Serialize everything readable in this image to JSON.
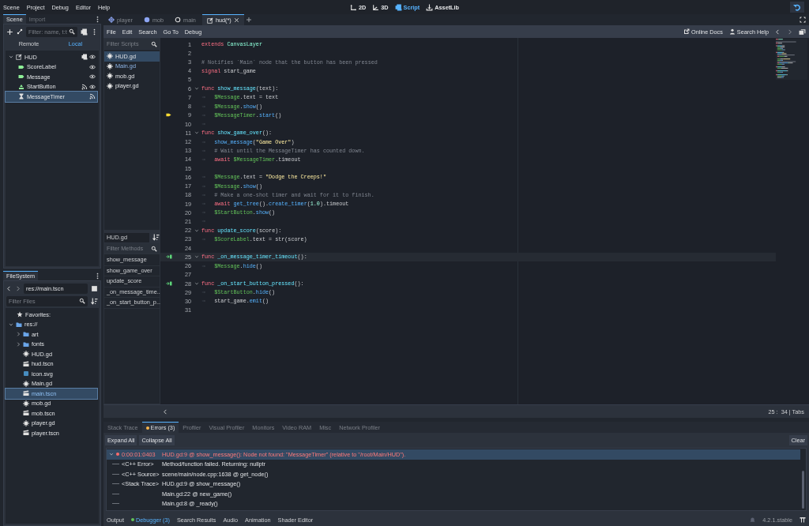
{
  "menu_bar": {
    "menus": [
      "Scene",
      "Project",
      "Debug",
      "Editor",
      "Help"
    ],
    "workspaces": [
      {
        "label": "2D",
        "kind": "canvas",
        "selected": false
      },
      {
        "label": "3D",
        "kind": "spatial",
        "selected": false
      },
      {
        "label": "Script",
        "kind": "script",
        "selected": true
      },
      {
        "label": "AssetLib",
        "kind": "assetlib",
        "selected": false
      }
    ]
  },
  "scene_dock": {
    "tabs": [
      {
        "label": "Scene",
        "selected": true
      },
      {
        "label": "Import",
        "selected": false
      }
    ],
    "filter": {
      "placeholder": "Filter: name, t:t"
    },
    "modes": [
      {
        "label": "Remote",
        "selected": false
      },
      {
        "label": "Local",
        "selected": true
      }
    ],
    "tree": {
      "name": "HUD",
      "kind": "canvas_layer",
      "expanded": true,
      "selected": false,
      "script": true,
      "signals": false,
      "eye": true,
      "children": [
        {
          "name": "ScoreLabel",
          "kind": "label",
          "selected": false,
          "script": false,
          "signals": false,
          "eye": true
        },
        {
          "name": "Message",
          "kind": "label",
          "selected": false,
          "script": false,
          "signals": false,
          "eye": true
        },
        {
          "name": "StartButton",
          "kind": "button",
          "selected": false,
          "script": false,
          "signals": true,
          "eye": true
        },
        {
          "name": "MessageTimer",
          "kind": "timer",
          "selected": true,
          "script": false,
          "signals": true,
          "eye": false
        }
      ]
    }
  },
  "filesystem": {
    "title": "FileSystem",
    "path": "res://main.tscn",
    "filter": {
      "placeholder": "Filter Files"
    },
    "favorites": "Favorites:",
    "tree": {
      "name": "res://",
      "kind": "folder",
      "expanded": true,
      "selected": false,
      "children": [
        {
          "name": "art",
          "kind": "folder",
          "expanded": false,
          "selected": false
        },
        {
          "name": "fonts",
          "kind": "folder",
          "expanded": false,
          "selected": false
        },
        {
          "name": "HUD.gd",
          "kind": "script",
          "selected": false
        },
        {
          "name": "hud.tscn",
          "kind": "scene",
          "selected": false
        },
        {
          "name": "icon.svg",
          "kind": "image",
          "selected": false
        },
        {
          "name": "Main.gd",
          "kind": "script",
          "selected": false
        },
        {
          "name": "main.tscn",
          "kind": "scene",
          "selected": true
        },
        {
          "name": "mob.gd",
          "kind": "script",
          "selected": false
        },
        {
          "name": "mob.tscn",
          "kind": "scene",
          "selected": false
        },
        {
          "name": "player.gd",
          "kind": "script",
          "selected": false
        },
        {
          "name": "player.tscn",
          "kind": "scene",
          "selected": false
        }
      ]
    }
  },
  "script_editor": {
    "tabs": [
      {
        "label": "player",
        "kind": "node2d",
        "selected": false
      },
      {
        "label": "mob",
        "kind": "rigid",
        "selected": false
      },
      {
        "label": "main",
        "kind": "node",
        "selected": false
      },
      {
        "label": "hud(*)",
        "kind": "canvas_layer",
        "selected": true
      }
    ],
    "menus": [
      "File",
      "Edit",
      "Search",
      "Go To",
      "Debug"
    ],
    "help_links": [
      "Online Docs",
      "Search Help"
    ],
    "scripts_filter": {
      "placeholder": "Filter Scripts"
    },
    "scripts": [
      {
        "label": "HUD.gd",
        "selected": true,
        "highlighted": false
      },
      {
        "label": "Main.gd",
        "selected": false,
        "highlighted": true
      },
      {
        "label": "mob.gd",
        "selected": false,
        "highlighted": false
      },
      {
        "label": "player.gd",
        "selected": false,
        "highlighted": false
      }
    ],
    "current_script": "HUD.gd",
    "methods_filter": {
      "placeholder": "Filter Methods"
    },
    "methods": [
      "show_message",
      "show_game_over",
      "update_score",
      "_on_message_time...",
      "_on_start_button_p..."
    ],
    "lines": [
      {
        "number": "1",
        "fold": false,
        "current": false,
        "tokens": [
          {
            "kind": "kw",
            "text": "extends"
          },
          {
            "kind": "type",
            "text": " CanvasLayer"
          }
        ]
      },
      {
        "number": "2",
        "fold": false,
        "current": false
      },
      {
        "number": "3",
        "fold": false,
        "current": false,
        "tokens": [
          {
            "kind": "comment",
            "text": "# Notifies `Main` node that the button has been pressed"
          }
        ]
      },
      {
        "number": "4",
        "fold": false,
        "current": false,
        "tokens": [
          {
            "kind": "kw",
            "text": "signal"
          },
          {
            "kind": "plain",
            "text": " start_game"
          }
        ]
      },
      {
        "number": "5",
        "fold": false,
        "current": false
      },
      {
        "number": "6",
        "fold": true,
        "current": false,
        "tokens": [
          {
            "kind": "kw",
            "text": "func"
          },
          {
            "kind": "fname",
            "text": " show_message"
          },
          {
            "kind": "plain",
            "text": "(text):"
          }
        ]
      },
      {
        "number": "7",
        "fold": false,
        "current": false,
        "tokens": [
          {
            "kind": "tab"
          },
          {
            "kind": "node",
            "text": "$Message"
          },
          {
            "kind": "plain",
            "text": ".text = text"
          }
        ]
      },
      {
        "number": "8",
        "fold": false,
        "current": false,
        "tokens": [
          {
            "kind": "tab"
          },
          {
            "kind": "node",
            "text": "$Message"
          },
          {
            "kind": "plain",
            "text": "."
          },
          {
            "kind": "call",
            "text": "show"
          },
          {
            "kind": "plain",
            "text": "()"
          }
        ]
      },
      {
        "number": "9",
        "fold": false,
        "current": false,
        "kind": "execution",
        "tokens": [
          {
            "kind": "tab"
          },
          {
            "kind": "node",
            "text": "$MessageTimer"
          },
          {
            "kind": "plain",
            "text": "."
          },
          {
            "kind": "call",
            "text": "start"
          },
          {
            "kind": "plain",
            "text": "()"
          }
        ]
      },
      {
        "number": "10",
        "fold": false,
        "current": false,
        "tokens": [
          {
            "kind": "tab"
          }
        ]
      },
      {
        "number": "11",
        "fold": true,
        "current": false,
        "tokens": [
          {
            "kind": "kw",
            "text": "func"
          },
          {
            "kind": "fname",
            "text": " show_game_over"
          },
          {
            "kind": "plain",
            "text": "():"
          }
        ]
      },
      {
        "number": "12",
        "fold": false,
        "current": false,
        "tokens": [
          {
            "kind": "tab"
          },
          {
            "kind": "call",
            "text": "show_message"
          },
          {
            "kind": "plain",
            "text": "("
          },
          {
            "kind": "str",
            "text": "\"Game Over\""
          },
          {
            "kind": "plain",
            "text": ")"
          }
        ]
      },
      {
        "number": "13",
        "fold": false,
        "current": false,
        "tokens": [
          {
            "kind": "tab"
          },
          {
            "kind": "comment",
            "text": "# Wait until the MessageTimer has counted down."
          }
        ]
      },
      {
        "number": "14",
        "fold": false,
        "current": false,
        "tokens": [
          {
            "kind": "tab"
          },
          {
            "kind": "kw",
            "text": "await"
          },
          {
            "kind": "node",
            "text": " $MessageTimer"
          },
          {
            "kind": "plain",
            "text": ".timeout"
          }
        ]
      },
      {
        "number": "15",
        "fold": false,
        "current": false
      },
      {
        "number": "16",
        "fold": false,
        "current": false,
        "tokens": [
          {
            "kind": "tab"
          },
          {
            "kind": "node",
            "text": "$Message"
          },
          {
            "kind": "plain",
            "text": ".text = "
          },
          {
            "kind": "str",
            "text": "\"Dodge the Creeps!\""
          }
        ]
      },
      {
        "number": "17",
        "fold": false,
        "current": false,
        "tokens": [
          {
            "kind": "tab"
          },
          {
            "kind": "node",
            "text": "$Message"
          },
          {
            "kind": "plain",
            "text": "."
          },
          {
            "kind": "call",
            "text": "show"
          },
          {
            "kind": "plain",
            "text": "()"
          }
        ]
      },
      {
        "number": "18",
        "fold": false,
        "current": false,
        "tokens": [
          {
            "kind": "tab"
          },
          {
            "kind": "comment",
            "text": "# Make a one-shot timer and wait for it to finish."
          }
        ]
      },
      {
        "number": "19",
        "fold": false,
        "current": false,
        "tokens": [
          {
            "kind": "tab"
          },
          {
            "kind": "kw",
            "text": "await"
          },
          {
            "kind": "call",
            "text": " get_tree"
          },
          {
            "kind": "plain",
            "text": "()."
          },
          {
            "kind": "call",
            "text": "create_timer"
          },
          {
            "kind": "plain",
            "text": "("
          },
          {
            "kind": "num",
            "text": "1.0"
          },
          {
            "kind": "plain",
            "text": ").timeout"
          }
        ]
      },
      {
        "number": "20",
        "fold": false,
        "current": false,
        "tokens": [
          {
            "kind": "tab"
          },
          {
            "kind": "node",
            "text": "$StartButton"
          },
          {
            "kind": "plain",
            "text": "."
          },
          {
            "kind": "call",
            "text": "show"
          },
          {
            "kind": "plain",
            "text": "()"
          }
        ]
      },
      {
        "number": "21",
        "fold": false,
        "current": false,
        "tokens": [
          {
            "kind": "tab"
          }
        ]
      },
      {
        "number": "22",
        "fold": true,
        "current": false,
        "tokens": [
          {
            "kind": "kw",
            "text": "func"
          },
          {
            "kind": "fname",
            "text": " update_score"
          },
          {
            "kind": "plain",
            "text": "(score):"
          }
        ]
      },
      {
        "number": "23",
        "fold": false,
        "current": false,
        "tokens": [
          {
            "kind": "tab"
          },
          {
            "kind": "node",
            "text": "$ScoreLabel"
          },
          {
            "kind": "plain",
            "text": ".text = str(score)"
          }
        ]
      },
      {
        "number": "24",
        "fold": false,
        "current": false
      },
      {
        "number": "25",
        "fold": true,
        "current": true,
        "kind": "signal",
        "tokens": [
          {
            "kind": "kw",
            "text": "func"
          },
          {
            "kind": "fname",
            "text": " _on_message_timer_timeout"
          },
          {
            "kind": "plain",
            "text": "():"
          }
        ]
      },
      {
        "number": "26",
        "fold": false,
        "current": false,
        "tokens": [
          {
            "kind": "tab"
          },
          {
            "kind": "node",
            "text": "$Message"
          },
          {
            "kind": "plain",
            "text": "."
          },
          {
            "kind": "call",
            "text": "hide"
          },
          {
            "kind": "plain",
            "text": "()"
          }
        ]
      },
      {
        "number": "27",
        "fold": false,
        "current": false
      },
      {
        "number": "28",
        "fold": true,
        "current": false,
        "kind": "signal",
        "tokens": [
          {
            "kind": "kw",
            "text": "func"
          },
          {
            "kind": "fname",
            "text": " _on_start_button_pressed"
          },
          {
            "kind": "plain",
            "text": "():"
          }
        ]
      },
      {
        "number": "29",
        "fold": false,
        "current": false,
        "tokens": [
          {
            "kind": "tab"
          },
          {
            "kind": "node",
            "text": "$StartButton"
          },
          {
            "kind": "plain",
            "text": "."
          },
          {
            "kind": "call",
            "text": "hide"
          },
          {
            "kind": "plain",
            "text": "()"
          }
        ]
      },
      {
        "number": "30",
        "fold": false,
        "current": false,
        "tokens": [
          {
            "kind": "tab"
          },
          {
            "kind": "plain",
            "text": "start_game."
          },
          {
            "kind": "call",
            "text": "emit"
          },
          {
            "kind": "plain",
            "text": "()"
          }
        ]
      },
      {
        "number": "31",
        "fold": false,
        "current": false
      }
    ],
    "status": "25 :  34 | Tabs"
  },
  "debugger": {
    "tabs": [
      {
        "label": "Stack Trace",
        "selected": false,
        "alert": false
      },
      {
        "label": "Errors (3)",
        "selected": true,
        "alert": true
      },
      {
        "label": "Profiler",
        "selected": false,
        "alert": false
      },
      {
        "label": "Visual Profiler",
        "selected": false,
        "alert": false
      },
      {
        "label": "Monitors",
        "selected": false,
        "alert": false
      },
      {
        "label": "Video RAM",
        "selected": false,
        "alert": false
      },
      {
        "label": "Misc",
        "selected": false,
        "alert": false
      },
      {
        "label": "Network Profiler",
        "selected": false,
        "alert": false
      }
    ],
    "buttons": [
      "Expand All",
      "Collapse All"
    ],
    "clear": "Clear",
    "errors": [
      {
        "time": "0:00:01:0403",
        "message": "HUD.gd:9 @ show_message(): Node not found: \"MessageTimer\" (relative to \"/root/Main/HUD\").",
        "expanded": true,
        "selected": true,
        "details": [
          {
            "label": "<C++ Error>",
            "value": "Method/function failed. Returning: nullptr"
          },
          {
            "label": "<C++ Source>",
            "value": "scene/main/node.cpp:1638 @ get_node()"
          },
          {
            "label": "<Stack Trace>",
            "value": "HUD.gd:9 @ show_message()"
          },
          {
            "value": "Main.gd:22 @ new_game()"
          },
          {
            "value": "Main.gd:8 @ _ready()"
          }
        ]
      }
    ]
  },
  "bottom_bar": {
    "tabs": [
      {
        "label": "Output",
        "selected": false,
        "alert": false
      },
      {
        "label": "Debugger (3)",
        "selected": true,
        "alert": true
      },
      {
        "label": "Search Results",
        "selected": false,
        "alert": false
      },
      {
        "label": "Audio",
        "selected": false,
        "alert": false
      },
      {
        "label": "Animation",
        "selected": false,
        "alert": false
      },
      {
        "label": "Shader Editor",
        "selected": false,
        "alert": false
      }
    ],
    "version": "4.2.1.stable"
  }
}
